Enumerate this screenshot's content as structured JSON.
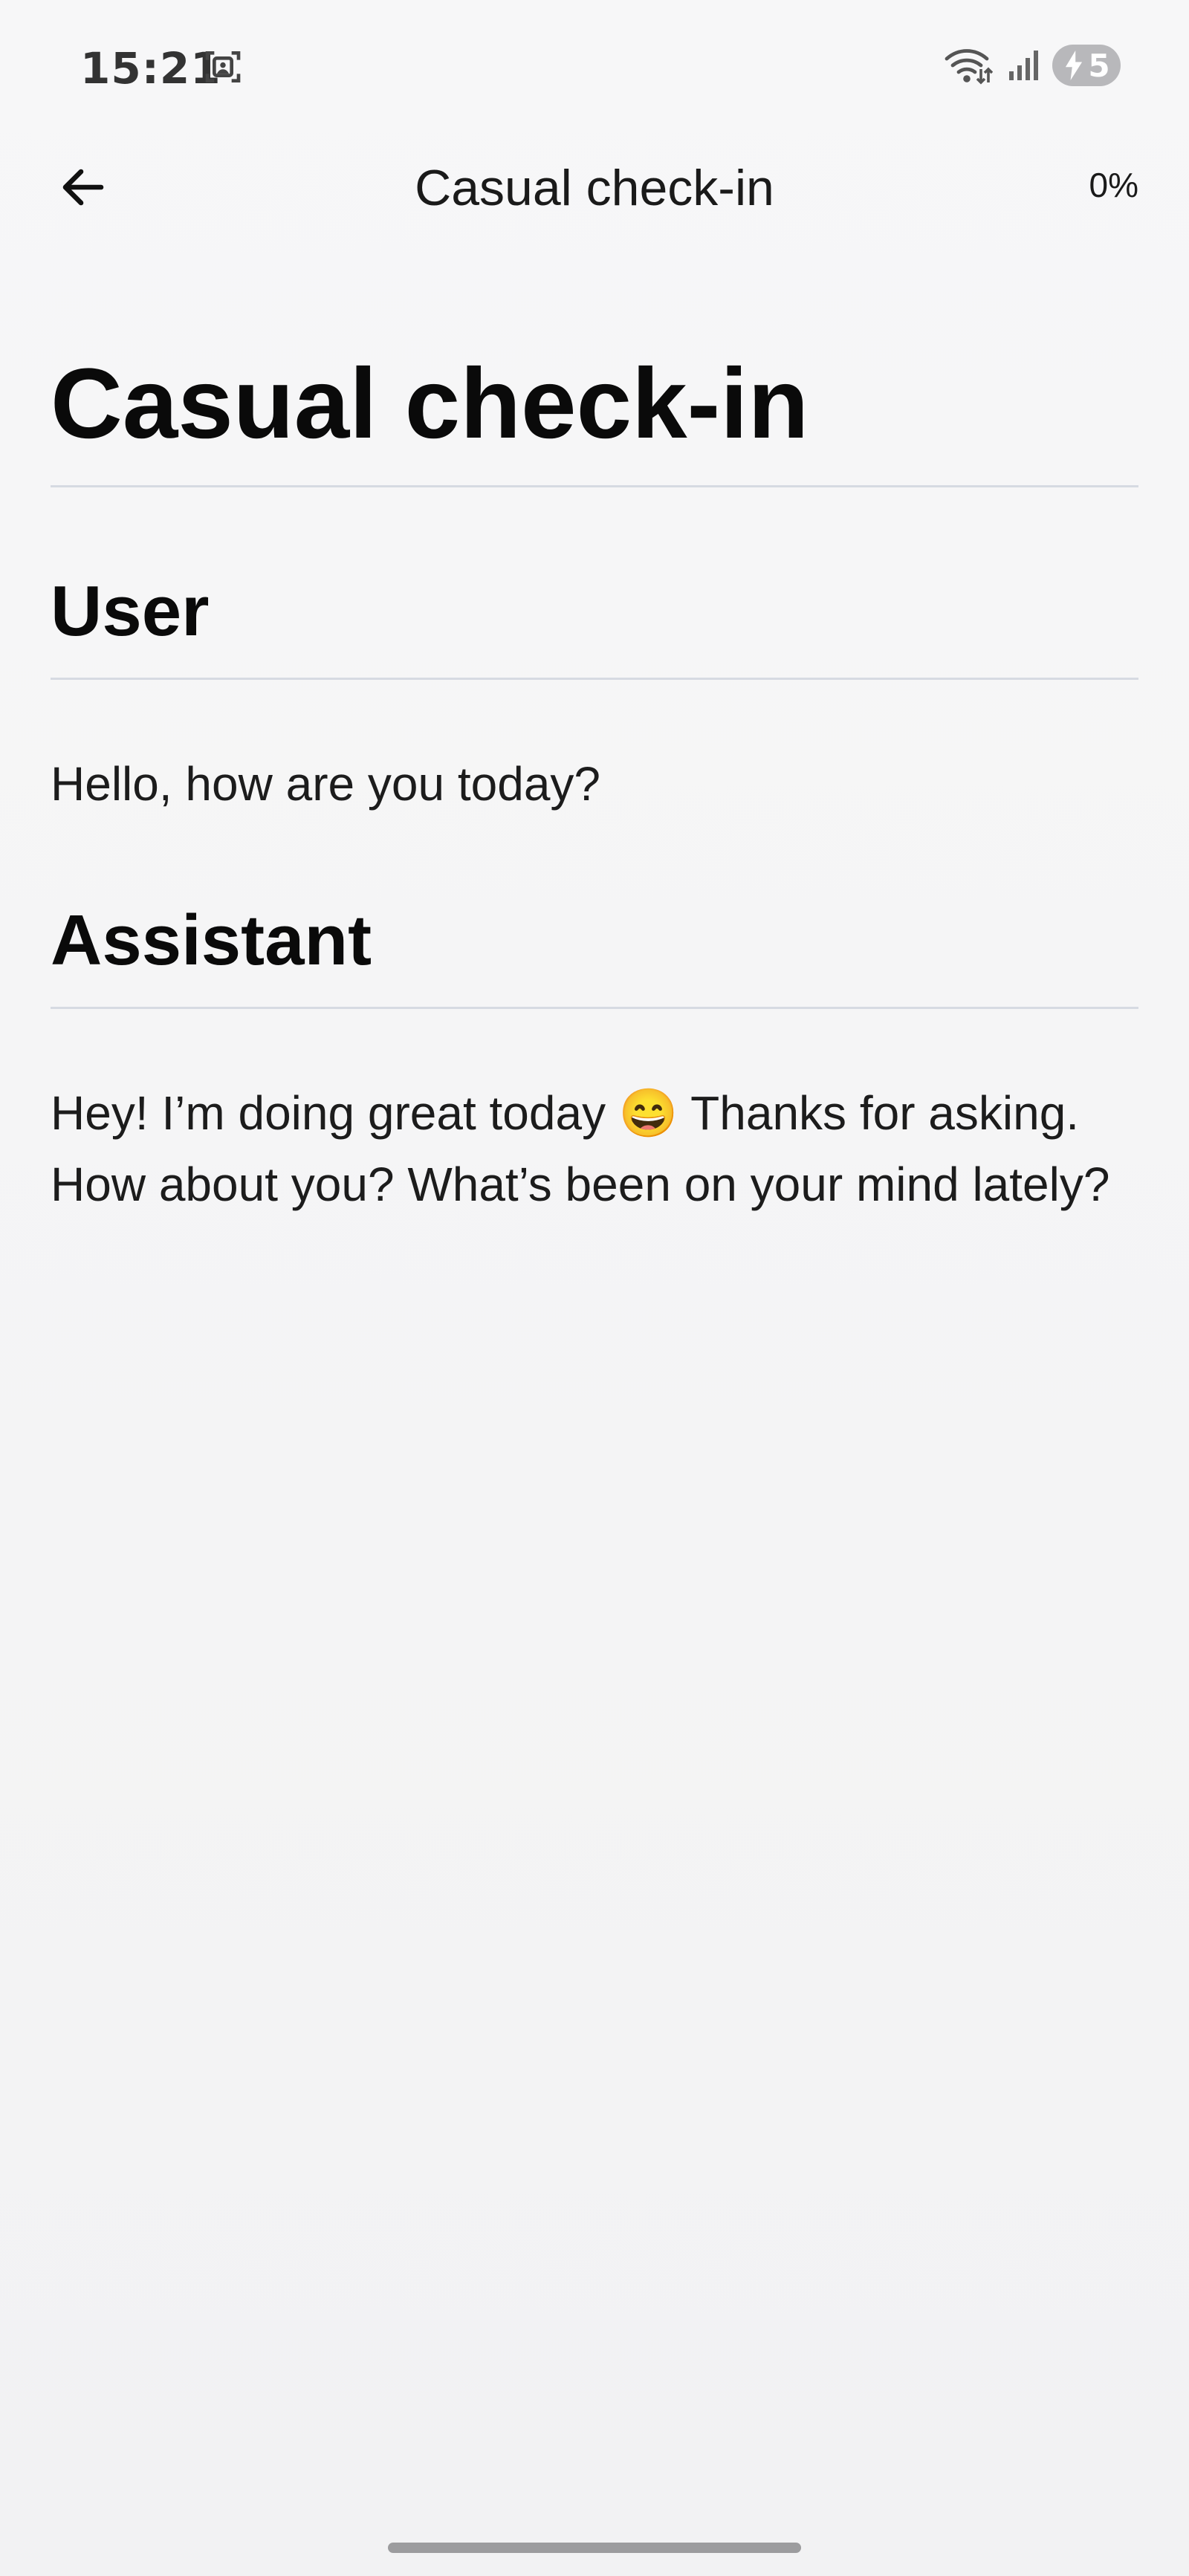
{
  "status_bar": {
    "time": "15:21",
    "battery_level": "5",
    "icons": [
      "screenshot-icon",
      "wifi-icon",
      "signal-icon",
      "battery-charging-icon"
    ]
  },
  "app_bar": {
    "title": "Casual check-in",
    "progress": "0%",
    "back_icon": "arrow-left-icon"
  },
  "document": {
    "title": "Casual check-in",
    "messages": [
      {
        "role": "User",
        "text": "Hello, how are you today?"
      },
      {
        "role": "Assistant",
        "text": "Hey! I’m doing great today 😄 Thanks for asking. How about you? What’s been on your mind lately?"
      }
    ]
  },
  "colors": {
    "background": "#f5f5f6",
    "divider": "#d6dae2",
    "battery_pill": "#b8b8bb",
    "text": "#111111"
  }
}
